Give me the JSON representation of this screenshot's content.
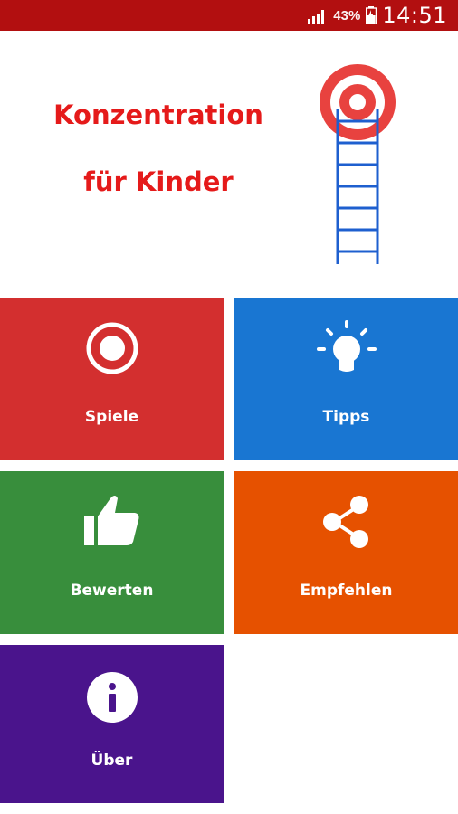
{
  "status_bar": {
    "battery_percent": "43%",
    "time": "14:51",
    "icons": [
      "signal-icon",
      "battery-icon"
    ]
  },
  "header": {
    "title_line1": "Konzentration",
    "title_line2": "für Kinder",
    "logo_icon": "target-ladder-logo"
  },
  "tiles": [
    {
      "label": "Spiele",
      "icon": "target-icon",
      "color": "#d32f2f"
    },
    {
      "label": "Tipps",
      "icon": "lightbulb-icon",
      "color": "#1976d2"
    },
    {
      "label": "Bewerten",
      "icon": "thumbs-up-icon",
      "color": "#388e3c"
    },
    {
      "label": "Empfehlen",
      "icon": "share-icon",
      "color": "#e65100"
    },
    {
      "label": "Über",
      "icon": "info-icon",
      "color": "#4a148c"
    }
  ],
  "colors": {
    "status_bar": "#b20f10",
    "title": "#e51a1a",
    "ladder": "#1e5fcf"
  }
}
